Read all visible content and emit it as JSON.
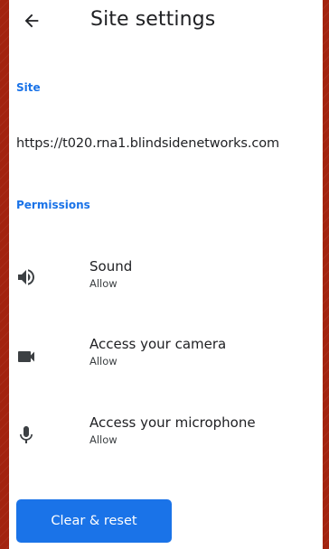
{
  "header": {
    "title": "Site settings",
    "back_icon": "arrow-back-icon"
  },
  "site_section": {
    "header": "Site",
    "url": "https://t020.rna1.blindsidenetworks.com"
  },
  "permissions_section": {
    "header": "Permissions",
    "items": [
      {
        "label": "Sound",
        "value": "Allow",
        "icon": "volume-icon"
      },
      {
        "label": "Access your camera",
        "value": "Allow",
        "icon": "videocam-icon"
      },
      {
        "label": "Access your microphone",
        "value": "Allow",
        "icon": "mic-icon"
      }
    ]
  },
  "actions": {
    "reset_label": "Clear & reset"
  },
  "colors": {
    "accent": "#1a73e8",
    "background_frame": "#a3230f",
    "text_primary": "#202124"
  }
}
